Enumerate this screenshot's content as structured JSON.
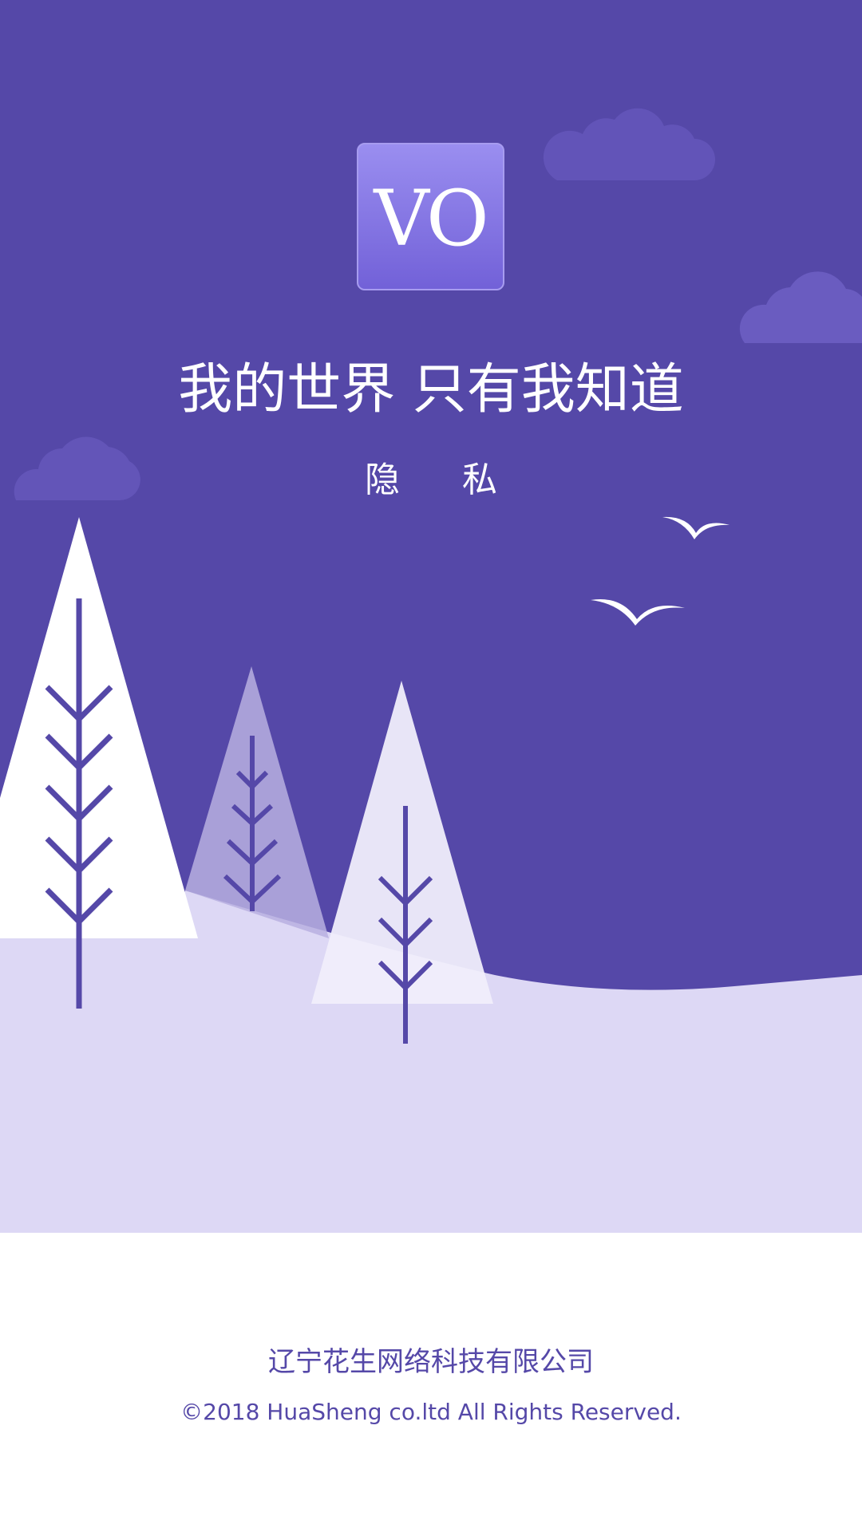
{
  "splash": {
    "logo_text": "VO",
    "slogan": "我的世界 只有我知道",
    "privacy_label": "隐 私"
  },
  "footer": {
    "company": "辽宁花生网络科技有限公司",
    "copyright": "©2018 HuaSheng co.ltd All Rights Reserved."
  },
  "colors": {
    "sky": "#5548a8",
    "ground": "#ddd8f5",
    "cloud": "#6a5cc0",
    "tree_white": "#ffffff",
    "tree_light": "#b8b0e0",
    "branch": "#5548a8",
    "footer_text": "#5548a8",
    "background": "#ffffff"
  },
  "icons": {
    "bird": "bird-icon",
    "cloud": "cloud-icon",
    "tree": "tree-icon"
  }
}
